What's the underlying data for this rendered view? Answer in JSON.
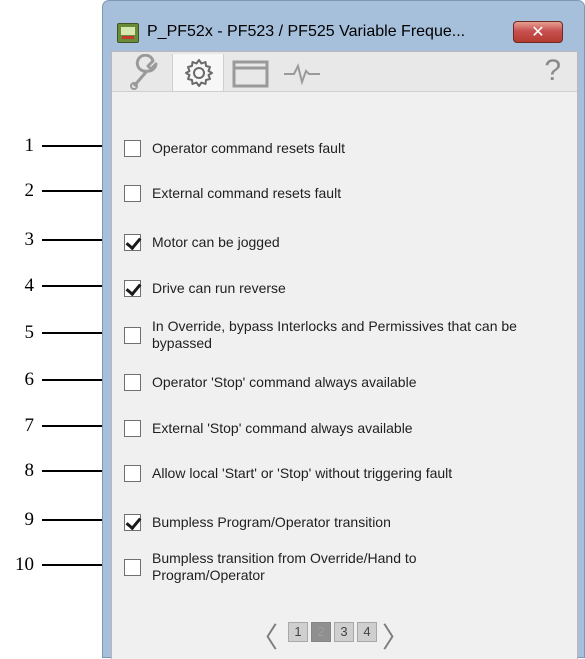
{
  "window": {
    "title": "P_PF52x - PF523 / PF525 Variable Freque...",
    "close_label": "✕"
  },
  "toolbar": {
    "tabs": [
      {
        "name": "wrench",
        "active": false
      },
      {
        "name": "gear",
        "active": true
      },
      {
        "name": "window",
        "active": false
      },
      {
        "name": "trend",
        "active": false
      }
    ],
    "help_label": "?"
  },
  "options": [
    {
      "label": "Operator command resets fault",
      "checked": false
    },
    {
      "label": "External command resets fault",
      "checked": false
    },
    {
      "label": "Motor can be jogged",
      "checked": true
    },
    {
      "label": "Drive can run reverse",
      "checked": true
    },
    {
      "label": "In Override, bypass Interlocks and Permissives that can be bypassed",
      "checked": false
    },
    {
      "label": "Operator 'Stop' command always available",
      "checked": false
    },
    {
      "label": "External 'Stop' command always available",
      "checked": false
    },
    {
      "label": "Allow local 'Start' or 'Stop' without triggering fault",
      "checked": false
    },
    {
      "label": "Bumpless Program/Operator transition",
      "checked": true
    },
    {
      "label": "Bumpless transition from Override/Hand to Program/Operator",
      "checked": false
    }
  ],
  "callouts": [
    "1",
    "2",
    "3",
    "4",
    "5",
    "6",
    "7",
    "8",
    "9",
    "10"
  ],
  "pager": {
    "prev": "〈",
    "next": "〉",
    "pages": [
      "1",
      "2",
      "3",
      "4"
    ],
    "current": "2"
  }
}
